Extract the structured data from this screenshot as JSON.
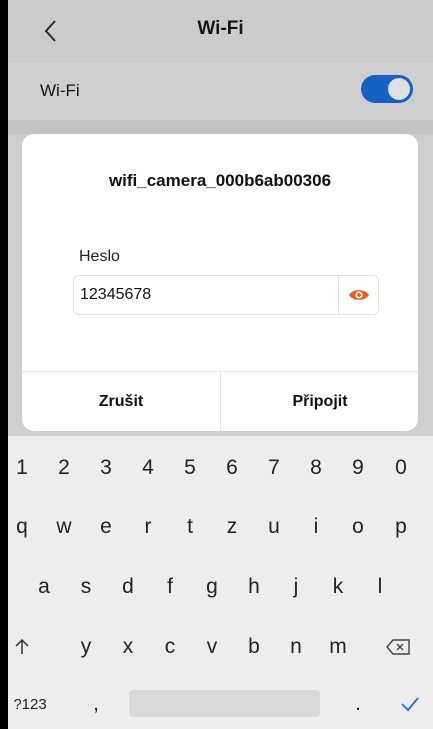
{
  "header": {
    "title": "Wi-Fi"
  },
  "wifi_row": {
    "label": "Wi-Fi",
    "enabled": true
  },
  "dialog": {
    "ssid": "wifi_camera_000b6ab00306",
    "password_label": "Heslo",
    "password_value": "12345678",
    "cancel_label": "Zrušit",
    "connect_label": "Připojit"
  },
  "colors": {
    "accent": "#1a6fe0",
    "eye": "#f05a16"
  },
  "keyboard": {
    "row_numbers": [
      "1",
      "2",
      "3",
      "4",
      "5",
      "6",
      "7",
      "8",
      "9",
      "0"
    ],
    "row1": [
      "q",
      "w",
      "e",
      "r",
      "t",
      "z",
      "u",
      "i",
      "o",
      "p"
    ],
    "row2": [
      "a",
      "s",
      "d",
      "f",
      "g",
      "h",
      "j",
      "k",
      "l"
    ],
    "row3": [
      "y",
      "x",
      "c",
      "v",
      "b",
      "n",
      "m"
    ],
    "sym_label": "?123",
    "comma": ",",
    "period": "."
  }
}
